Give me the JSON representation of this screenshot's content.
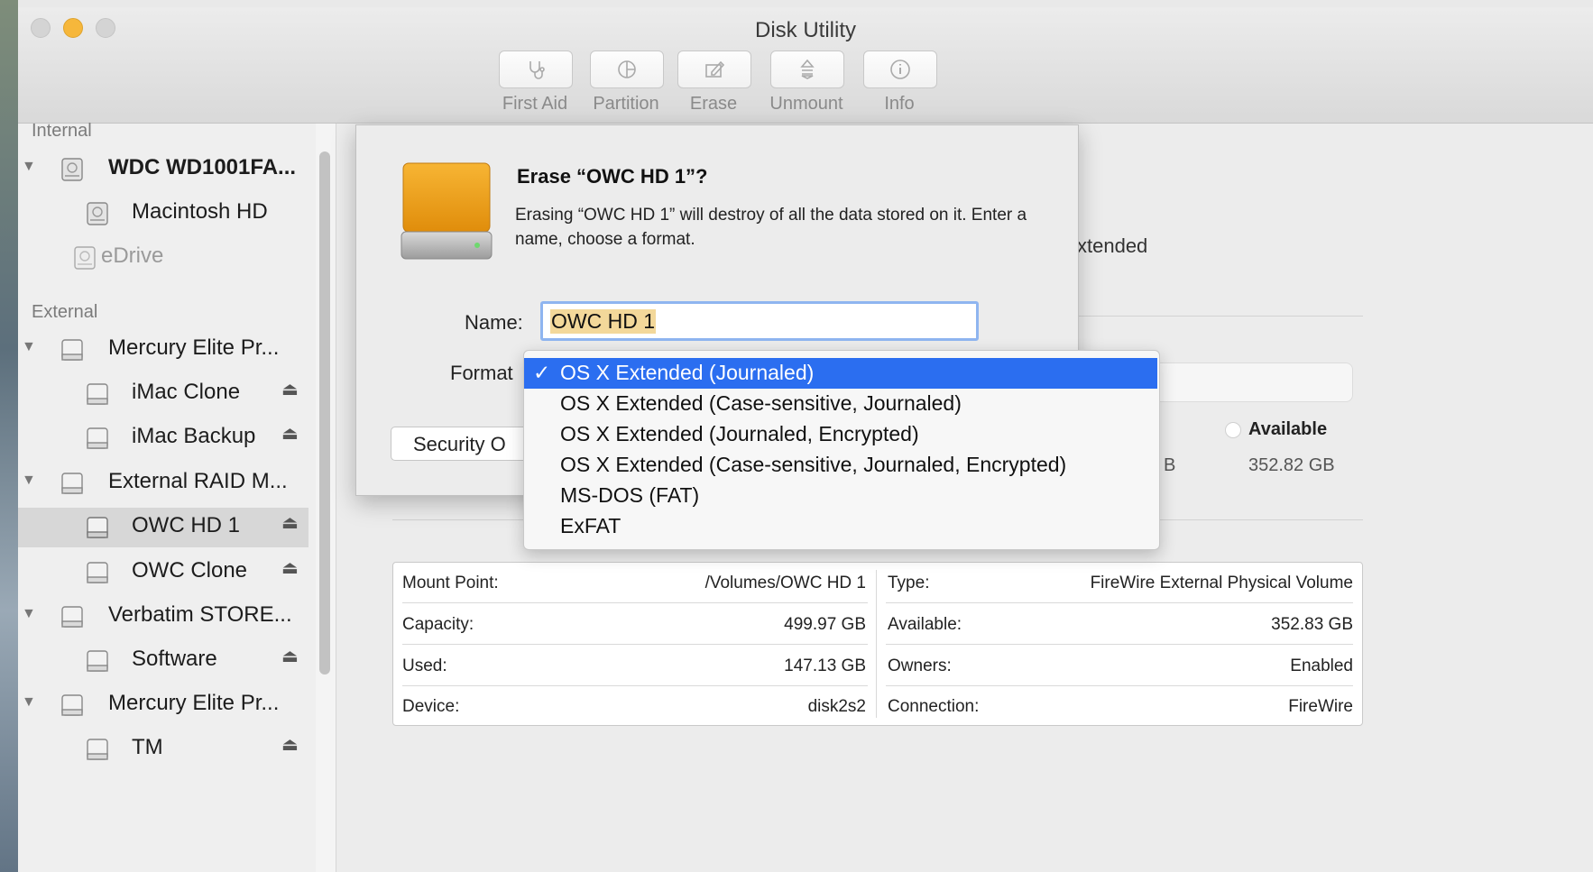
{
  "window": {
    "title": "Disk Utility"
  },
  "toolbar": {
    "buttons": [
      {
        "label": "First Aid",
        "icon": "stethoscope-icon"
      },
      {
        "label": "Partition",
        "icon": "partition-icon"
      },
      {
        "label": "Erase",
        "icon": "erase-icon"
      },
      {
        "label": "Unmount",
        "icon": "unmount-icon"
      },
      {
        "label": "Info",
        "icon": "info-icon"
      }
    ]
  },
  "sidebar": {
    "sections": [
      "Internal",
      "External"
    ],
    "items": [
      {
        "label": "WDC WD1001FA..."
      },
      {
        "label": "Macintosh HD"
      },
      {
        "label": "eDrive"
      },
      {
        "label": "Mercury Elite Pr..."
      },
      {
        "label": "iMac Clone",
        "eject": "⏏"
      },
      {
        "label": "iMac Backup",
        "eject": "⏏"
      },
      {
        "label": "External RAID M..."
      },
      {
        "label": "OWC HD 1",
        "eject": "⏏"
      },
      {
        "label": "OWC Clone",
        "eject": "⏏"
      },
      {
        "label": "Verbatim STORE..."
      },
      {
        "label": "Software",
        "eject": "⏏"
      },
      {
        "label": "Mercury Elite Pr..."
      },
      {
        "label": "TM",
        "eject": "⏏"
      }
    ]
  },
  "main": {
    "partial_format": "xtended",
    "available_header": "Available",
    "available_value": "352.82 GB",
    "partial_used_unit": "B"
  },
  "info_table": {
    "left": [
      {
        "label": "Mount Point:",
        "value": "/Volumes/OWC HD 1"
      },
      {
        "label": "Capacity:",
        "value": "499.97 GB"
      },
      {
        "label": "Used:",
        "value": "147.13 GB"
      },
      {
        "label": "Device:",
        "value": "disk2s2"
      }
    ],
    "right": [
      {
        "label": "Type:",
        "value": "FireWire External Physical Volume"
      },
      {
        "label": "Available:",
        "value": "352.83 GB"
      },
      {
        "label": "Owners:",
        "value": "Enabled"
      },
      {
        "label": "Connection:",
        "value": "FireWire"
      }
    ]
  },
  "dialog": {
    "title": "Erase “OWC HD 1”?",
    "message": "Erasing “OWC HD 1” will destroy of all the data stored on it. Enter a name, choose a format.",
    "name_label": "Name:",
    "name_value": "OWC HD 1",
    "format_label": "Format",
    "security_button": "Security O"
  },
  "format_menu": {
    "check": "✓",
    "options": [
      "OS X Extended (Journaled)",
      "OS X Extended (Case-sensitive, Journaled)",
      "OS X Extended (Journaled, Encrypted)",
      "OS X Extended (Case-sensitive, Journaled, Encrypted)",
      "MS-DOS (FAT)",
      "ExFAT"
    ]
  }
}
